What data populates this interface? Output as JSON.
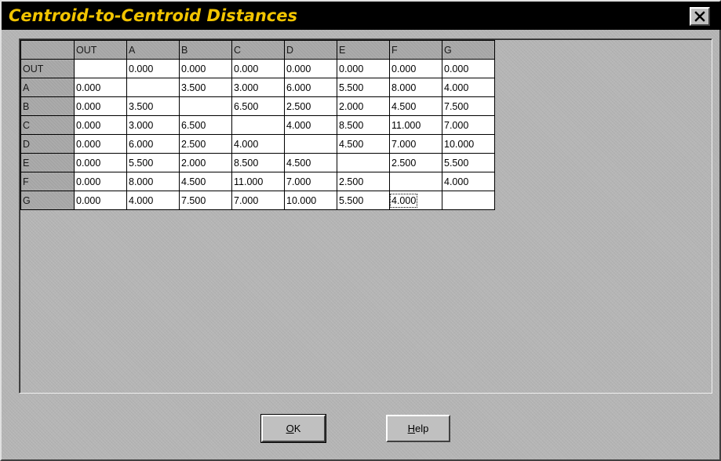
{
  "window": {
    "title": "Centroid-to-Centroid Distances",
    "title_color": "#f2c400",
    "title_bar_color": "#000000",
    "close_icon": "close-icon"
  },
  "grid": {
    "columns": [
      "OUT",
      "A",
      "B",
      "C",
      "D",
      "E",
      "F",
      "G"
    ],
    "rows": [
      {
        "label": "OUT",
        "values": [
          "",
          "0.000",
          "0.000",
          "0.000",
          "0.000",
          "0.000",
          "0.000",
          "0.000"
        ]
      },
      {
        "label": "A",
        "values": [
          "0.000",
          "",
          "3.500",
          "3.000",
          "6.000",
          "5.500",
          "8.000",
          "4.000"
        ]
      },
      {
        "label": "B",
        "values": [
          "0.000",
          "3.500",
          "",
          "6.500",
          "2.500",
          "2.000",
          "4.500",
          "7.500"
        ]
      },
      {
        "label": "C",
        "values": [
          "0.000",
          "3.000",
          "6.500",
          "",
          "4.000",
          "8.500",
          "11.000",
          "7.000"
        ]
      },
      {
        "label": "D",
        "values": [
          "0.000",
          "6.000",
          "2.500",
          "4.000",
          "",
          "4.500",
          "7.000",
          "10.000"
        ]
      },
      {
        "label": "E",
        "values": [
          "0.000",
          "5.500",
          "2.000",
          "8.500",
          "4.500",
          "",
          "2.500",
          "5.500"
        ]
      },
      {
        "label": "F",
        "values": [
          "0.000",
          "8.000",
          "4.500",
          "11.000",
          "7.000",
          "2.500",
          "",
          "4.000"
        ]
      },
      {
        "label": "G",
        "values": [
          "0.000",
          "4.000",
          "7.500",
          "7.000",
          "10.000",
          "5.500",
          "4.000",
          ""
        ]
      }
    ],
    "focused_cell": {
      "row": "G",
      "column": "F"
    }
  },
  "buttons": {
    "ok": {
      "mnemonic": "O",
      "rest": "K"
    },
    "help": {
      "mnemonic": "H",
      "rest": "elp"
    }
  }
}
